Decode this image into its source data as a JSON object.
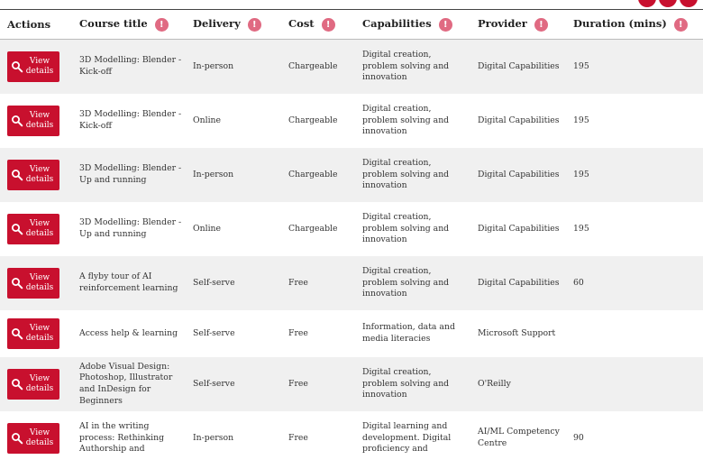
{
  "columns": [
    {
      "key": "actions",
      "label": "Actions",
      "info": false
    },
    {
      "key": "title",
      "label": "Course title",
      "info": true
    },
    {
      "key": "delivery",
      "label": "Delivery",
      "info": true
    },
    {
      "key": "cost",
      "label": "Cost",
      "info": true
    },
    {
      "key": "capabilities",
      "label": "Capabilities",
      "info": true
    },
    {
      "key": "provider",
      "label": "Provider",
      "info": true
    },
    {
      "key": "duration",
      "label": "Duration (mins)",
      "info": true
    }
  ],
  "info_glyph": "!",
  "view_button_label": "View details",
  "accent_color": "#c8102e",
  "info_color": "#e06a82",
  "icons": {
    "view_button": "search-icon",
    "header_info": "info-icon"
  },
  "rows": [
    {
      "title": "3D Modelling: Blender - Kick-off",
      "delivery": "In-person",
      "cost": "Chargeable",
      "capabilities": "Digital creation, problem solving and innovation",
      "provider": "Digital Capabilities",
      "duration": "195"
    },
    {
      "title": "3D Modelling: Blender - Kick-off",
      "delivery": "Online",
      "cost": "Chargeable",
      "capabilities": "Digital creation, problem solving and innovation",
      "provider": "Digital Capabilities",
      "duration": "195"
    },
    {
      "title": "3D Modelling: Blender - Up and running",
      "delivery": "In-person",
      "cost": "Chargeable",
      "capabilities": "Digital creation, problem solving and innovation",
      "provider": "Digital Capabilities",
      "duration": "195"
    },
    {
      "title": "3D Modelling: Blender - Up and running",
      "delivery": "Online",
      "cost": "Chargeable",
      "capabilities": "Digital creation, problem solving and innovation",
      "provider": "Digital Capabilities",
      "duration": "195"
    },
    {
      "title": "A flyby tour of AI reinforcement learning",
      "delivery": "Self-serve",
      "cost": "Free",
      "capabilities": "Digital creation, problem solving and innovation",
      "provider": "Digital Capabilities",
      "duration": "60"
    },
    {
      "title": "Access help & learning",
      "delivery": "Self-serve",
      "cost": "Free",
      "capabilities": "Information, data and media literacies",
      "provider": "Microsoft Support",
      "duration": ""
    },
    {
      "title": "Adobe Visual Design: Photoshop, Illustrator and InDesign for Beginners",
      "delivery": "Self-serve",
      "cost": "Free",
      "capabilities": "Digital creation, problem solving and innovation",
      "provider": "O'Reilly",
      "duration": ""
    },
    {
      "title": "AI in the writing process: Rethinking Authorship and",
      "delivery": "In-person",
      "cost": "Free",
      "capabilities": "Digital learning and development. Digital proficiency and",
      "provider": "AI/ML Competency Centre",
      "duration": "90"
    }
  ]
}
